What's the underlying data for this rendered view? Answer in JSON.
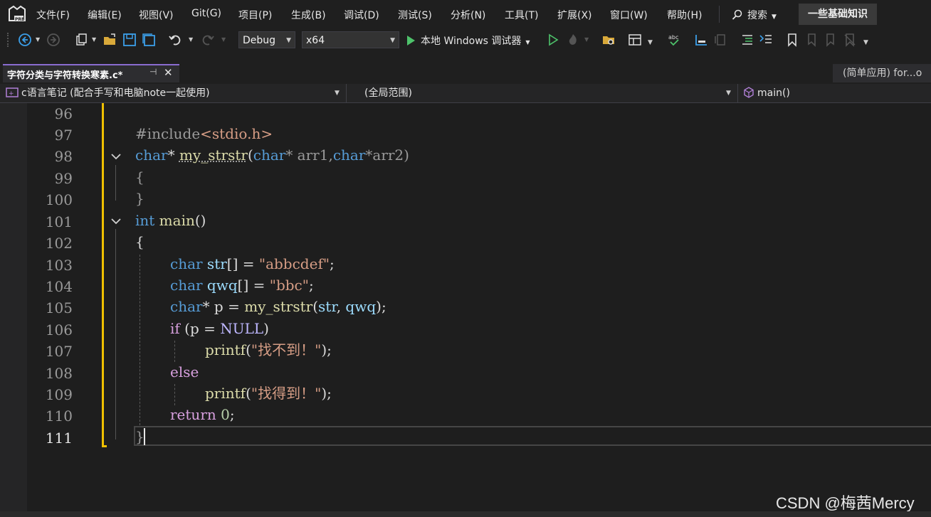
{
  "menu": {
    "items": [
      "文件(F)",
      "编辑(E)",
      "视图(V)",
      "Git(G)",
      "项目(P)",
      "生成(B)",
      "调试(D)",
      "测试(S)",
      "分析(N)",
      "工具(T)",
      "扩展(X)",
      "窗口(W)",
      "帮助(H)"
    ],
    "search_label": "搜索",
    "solution_name": "一些基础知识"
  },
  "toolbar": {
    "config": "Debug",
    "platform": "x64",
    "run_label": "本地 Windows 调试器"
  },
  "tabs": {
    "active_title": "字符分类与字符转换寒素.c*",
    "right_title": "(简单应用)  for...o"
  },
  "navbar": {
    "project": "c语言笔记  (配合手写和电脑note一起使用)",
    "scope": "(全局范围)",
    "member": "main()"
  },
  "editor": {
    "line_numbers": [
      "96",
      "97",
      "98",
      "99",
      "100",
      "101",
      "102",
      "103",
      "104",
      "105",
      "106",
      "107",
      "108",
      "109",
      "110",
      "111"
    ],
    "current_line": "111"
  },
  "code": {
    "l97_pp": "#include",
    "l97_hdr": "<stdio.h>",
    "l98_kw1": "char",
    "l98_p1": "* ",
    "l98_fn": "my_strstr",
    "l98_p2": "(",
    "l98_kw2": "char",
    "l98_p3": "* arr1,",
    "l98_kw3": "char",
    "l98_p4": "*arr2)",
    "l99": "{",
    "l100": "}",
    "l101_kw": "int",
    "l101_fn": " main",
    "l101_p": "()",
    "l102": "{",
    "l103_kw": "char",
    "l103_var": " str",
    "l103_p": "[] = ",
    "l103_str": "\"abbcdef\"",
    "l103_end": ";",
    "l104_kw": "char",
    "l104_var": " qwq",
    "l104_p": "[] = ",
    "l104_str": "\"bbc\"",
    "l104_end": ";",
    "l105_kw": "char",
    "l105_p1": "* p = ",
    "l105_fn": "my_strstr",
    "l105_p2": "(",
    "l105_v1": "str",
    "l105_p3": ", ",
    "l105_v2": "qwq",
    "l105_p4": ");",
    "l106_ctl": "if",
    "l106_p1": " (p = ",
    "l106_mac": "NULL",
    "l106_p2": ")",
    "l107_fn": "printf",
    "l107_p1": "(",
    "l107_str": "\"找不到！\"",
    "l107_p2": ");",
    "l108_ctl": "else",
    "l109_fn": "printf",
    "l109_p1": "(",
    "l109_str": "\"找得到！\"",
    "l109_p2": ");",
    "l110_ctl": "return",
    "l110_num": " 0",
    "l110_p": ";",
    "l111": "}"
  },
  "watermark": "CSDN @梅茜Mercy",
  "colors": {
    "keyword": "#569cd6",
    "control": "#d8a0df",
    "function": "#dcdcaa",
    "string": "#d69d85",
    "change_bar": "#f0c000",
    "tab_accent": "#8a6cd0"
  }
}
